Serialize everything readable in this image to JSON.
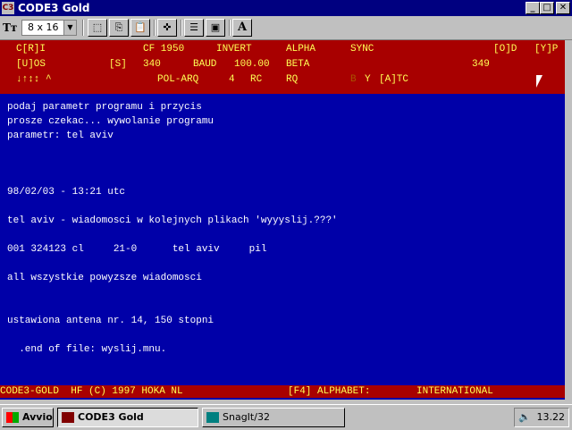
{
  "window": {
    "title": "CODE3 Gold",
    "icon_text": "C3",
    "minimize_glyph": "_",
    "maximize_glyph": "□",
    "close_glyph": "✕"
  },
  "toolbar": {
    "font_icon": "Tт",
    "font_size_value": "8 x 16",
    "select_arrow": "▼",
    "buttons": [
      {
        "name": "mark-icon",
        "glyph": "⬚"
      },
      {
        "name": "copy-icon",
        "glyph": "⎘"
      },
      {
        "name": "paste-icon",
        "glyph": "📋"
      },
      {
        "name": "fullscreen-icon",
        "glyph": "✜"
      },
      {
        "name": "properties-icon",
        "glyph": "☰"
      },
      {
        "name": "background-icon",
        "glyph": "▣"
      },
      {
        "name": "font-icon",
        "glyph": "A"
      }
    ]
  },
  "status": {
    "row1": [
      "C[R]I",
      "CF 1950",
      "INVERT",
      "ALPHA",
      "SYNC",
      "[O]D",
      "[Y]P"
    ],
    "row2": [
      "[U]OS",
      "[S]",
      "340",
      "BAUD",
      "100.00",
      "BETA",
      "349"
    ],
    "row3": [
      "↓↑↕↕ ^",
      "POL-ARQ",
      "4",
      "RC",
      "RQ",
      "B",
      "Y",
      "[A]TC"
    ]
  },
  "terminal": {
    "lines": [
      "podaj parametr programu i przycis",
      "prosze czekac... wywolanie programu",
      "parametr: tel aviv",
      "98/02/03 - 13:21 utc",
      "tel aviv - wiadomosci w kolejnych plikach 'wyyyslij.???'",
      "001 324123 cl     21-0      tel aviv     pil",
      "all wszystkie powyzsze wiadomosci",
      "ustawiona antena nr. 14, 150 stopni",
      "  .end of file: wyslij.mnu."
    ],
    "footer": [
      "CODE3-GOLD  HF (C) 1997 HOKA NL",
      "[F4] ALPHABET:",
      "INTERNATIONAL"
    ]
  },
  "taskbar": {
    "start_label": "Avvio",
    "tasks": [
      "CODE3 Gold",
      "SnagIt/32"
    ],
    "clock": "13.22"
  },
  "colors": {
    "terminal_bg": "#0000a8",
    "status_bg": "#a80000",
    "status_text": "#ffff55",
    "title_bar": "#000080"
  }
}
